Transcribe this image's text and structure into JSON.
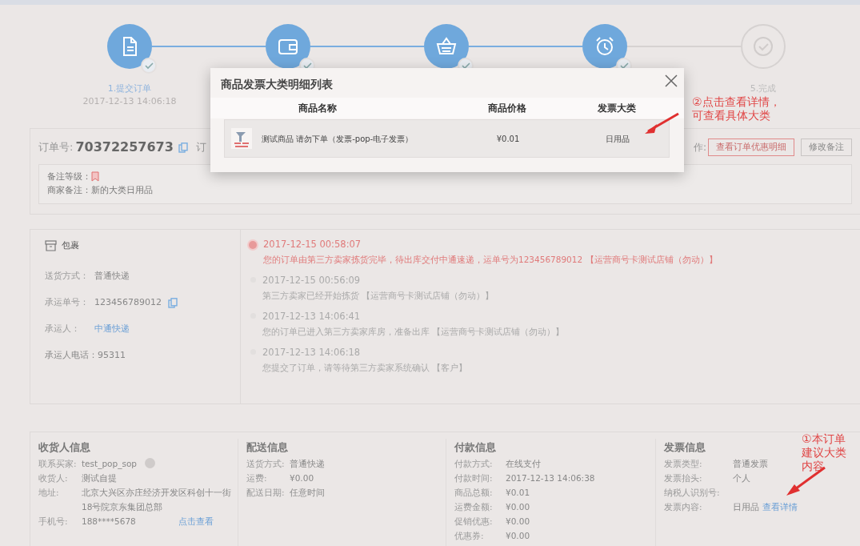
{
  "steps": [
    {
      "label": "1.提交订单",
      "time": "2017-12-13 14:06:18",
      "done": true
    },
    {
      "done": true
    },
    {
      "done": true
    },
    {
      "done": true
    },
    {
      "label": "5.完成",
      "done": false
    }
  ],
  "order": {
    "number_label": "订单号:",
    "number": "70372257673",
    "cut_label": "订",
    "actions_label": "作:",
    "buttons": [
      {
        "label": "查看订单优惠明细",
        "kind": "primary"
      },
      {
        "label": "修改备注",
        "kind": "default"
      }
    ],
    "remark": {
      "level_label": "备注等级：",
      "note_label": "商家备注：",
      "note": "新的大类日用品"
    }
  },
  "package": {
    "title": "包裹",
    "fields": [
      {
        "label": "送货方式：",
        "value": "普通快递",
        "kind": "text"
      },
      {
        "label": "承运单号：",
        "value": "123456789012",
        "kind": "copy"
      },
      {
        "label": "承运人：",
        "value": "中通快递",
        "kind": "link"
      },
      {
        "label": "承运人电话：",
        "value": "95311",
        "kind": "inline"
      }
    ]
  },
  "timeline": [
    {
      "time": "2017-12-15 00:58:07",
      "text": "您的订单由第三方卖家拣货完毕，待出库交付中通速递，运单号为123456789012 【运营商号卡测试店铺（勿动）】",
      "current": true
    },
    {
      "time": "2017-12-15 00:56:09",
      "text": "第三方卖家已经开始拣货 【运营商号卡测试店铺（勿动）】",
      "current": false
    },
    {
      "time": "2017-12-13 14:06:41",
      "text": "您的订单已进入第三方卖家库房，准备出库 【运营商号卡测试店铺（勿动）】",
      "current": false
    },
    {
      "time": "2017-12-13 14:06:18",
      "text": "您提交了订单，请等待第三方卖家系统确认 【客户】",
      "current": false
    }
  ],
  "info_sections": [
    {
      "title": "收货人信息",
      "rows": [
        {
          "label": "联系买家:",
          "value": "test_pop_sop",
          "kind": "contact"
        },
        {
          "label": "收货人:",
          "value": "测试自提",
          "kind": "text"
        },
        {
          "label": "地址:",
          "lines": [
            "北京大兴区亦庄经济开发区科创十一街",
            "18号院京东集团总部"
          ],
          "kind": "text"
        },
        {
          "label": "手机号:",
          "value": "188****5678",
          "kind": "text",
          "link": "点击查看"
        }
      ]
    },
    {
      "title": "配送信息",
      "rows": [
        {
          "label": "送货方式:",
          "value": "普通快递",
          "kind": "text"
        },
        {
          "label": "运费:",
          "value": "¥0.00",
          "kind": "text"
        },
        {
          "label": "配送日期:",
          "value": "任意时间",
          "kind": "text"
        }
      ]
    },
    {
      "title": "付款信息",
      "rows": [
        {
          "label": "付款方式:",
          "value": "在线支付",
          "kind": "text"
        },
        {
          "label": "付款时间:",
          "value": "2017-12-13 14:06:38",
          "kind": "text"
        },
        {
          "label": "商品总额:",
          "value": "¥0.01",
          "kind": "text"
        },
        {
          "label": "运费金额:",
          "value": "¥0.00",
          "kind": "text"
        },
        {
          "label": "促销优惠:",
          "value": "¥0.00",
          "kind": "text"
        },
        {
          "label": "优惠券:",
          "value": "¥0.00",
          "kind": "text"
        }
      ]
    },
    {
      "title": "发票信息",
      "rows": [
        {
          "label": "发票类型:",
          "value": "普通发票",
          "kind": "text"
        },
        {
          "label": "发票抬头:",
          "value": "个人",
          "kind": "text"
        },
        {
          "label": "纳税人识别号:",
          "kind": "text"
        },
        {
          "label": "发票内容:",
          "value": "日用品",
          "kind": "text",
          "link": "查看详情"
        }
      ]
    }
  ],
  "modal": {
    "title": "商品发票大类明细列表",
    "columns": [
      "商品名称",
      "商品价格",
      "发票大类"
    ],
    "rows": [
      {
        "name": "测试商品 请勿下单（发票-pop-电子发票）",
        "price": "¥0.01",
        "category": "日用品"
      }
    ]
  },
  "annotations": [
    {
      "lines": [
        "②点击查看详情，",
        "可查看具体大类"
      ]
    },
    {
      "lines": [
        "①本订单",
        "建议大类",
        "内容"
      ]
    }
  ]
}
